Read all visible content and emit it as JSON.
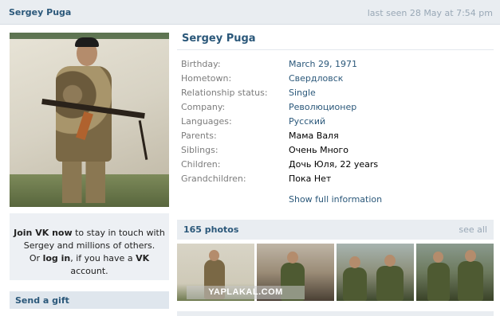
{
  "topbar": {
    "name": "Sergey Puga",
    "last_seen": "last seen 28 May at 7:54 pm"
  },
  "profile": {
    "name": "Sergey Puga",
    "info": [
      {
        "key": "Birthday:",
        "value": "March 29, 1971",
        "link": true
      },
      {
        "key": "Hometown:",
        "value": "Свердловск",
        "link": true
      },
      {
        "key": "Relationship status:",
        "value": "Single",
        "link": true
      },
      {
        "key": "Company:",
        "value": "Революционер",
        "link": true
      },
      {
        "key": "Languages:",
        "value": "Русский",
        "link": true
      },
      {
        "key": "Parents:",
        "value": "Мама Валя",
        "link": false
      },
      {
        "key": "Siblings:",
        "value": "Очень Много",
        "link": false
      },
      {
        "key": "Children:",
        "value": "Дочь Юля, 22 years",
        "link": false
      },
      {
        "key": "Grandchildren:",
        "value": "Пока Нет",
        "link": false
      }
    ],
    "show_full": "Show full information"
  },
  "join": {
    "line1_bold": "Join VK now",
    "line1_rest": " to stay in touch with",
    "line2": "Sergey and millions of others.",
    "line3_a": "Or ",
    "line3_bold": "log in",
    "line3_b": ", if you have a ",
    "line3_vk": "VK",
    "line3_c": " account."
  },
  "gift": {
    "label": "Send a gift"
  },
  "photos": {
    "title": "165 photos",
    "see_all": "see all"
  },
  "watermark": "YAPLAKAL.COM"
}
